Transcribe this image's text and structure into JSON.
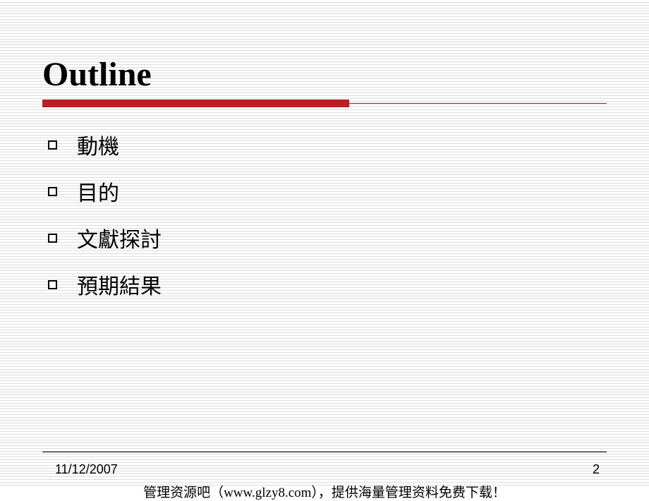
{
  "slide": {
    "title": "Outline",
    "bullets": [
      "動機",
      "目的",
      "文獻探討",
      "預期結果"
    ]
  },
  "footer": {
    "date": "11/12/2007",
    "page": "2",
    "source_text": "管理资源吧（www.glzy8.com），提供海量管理资料免费下载！"
  },
  "colors": {
    "accent_red": "#b92025",
    "line_gray": "#dbdbdb"
  }
}
